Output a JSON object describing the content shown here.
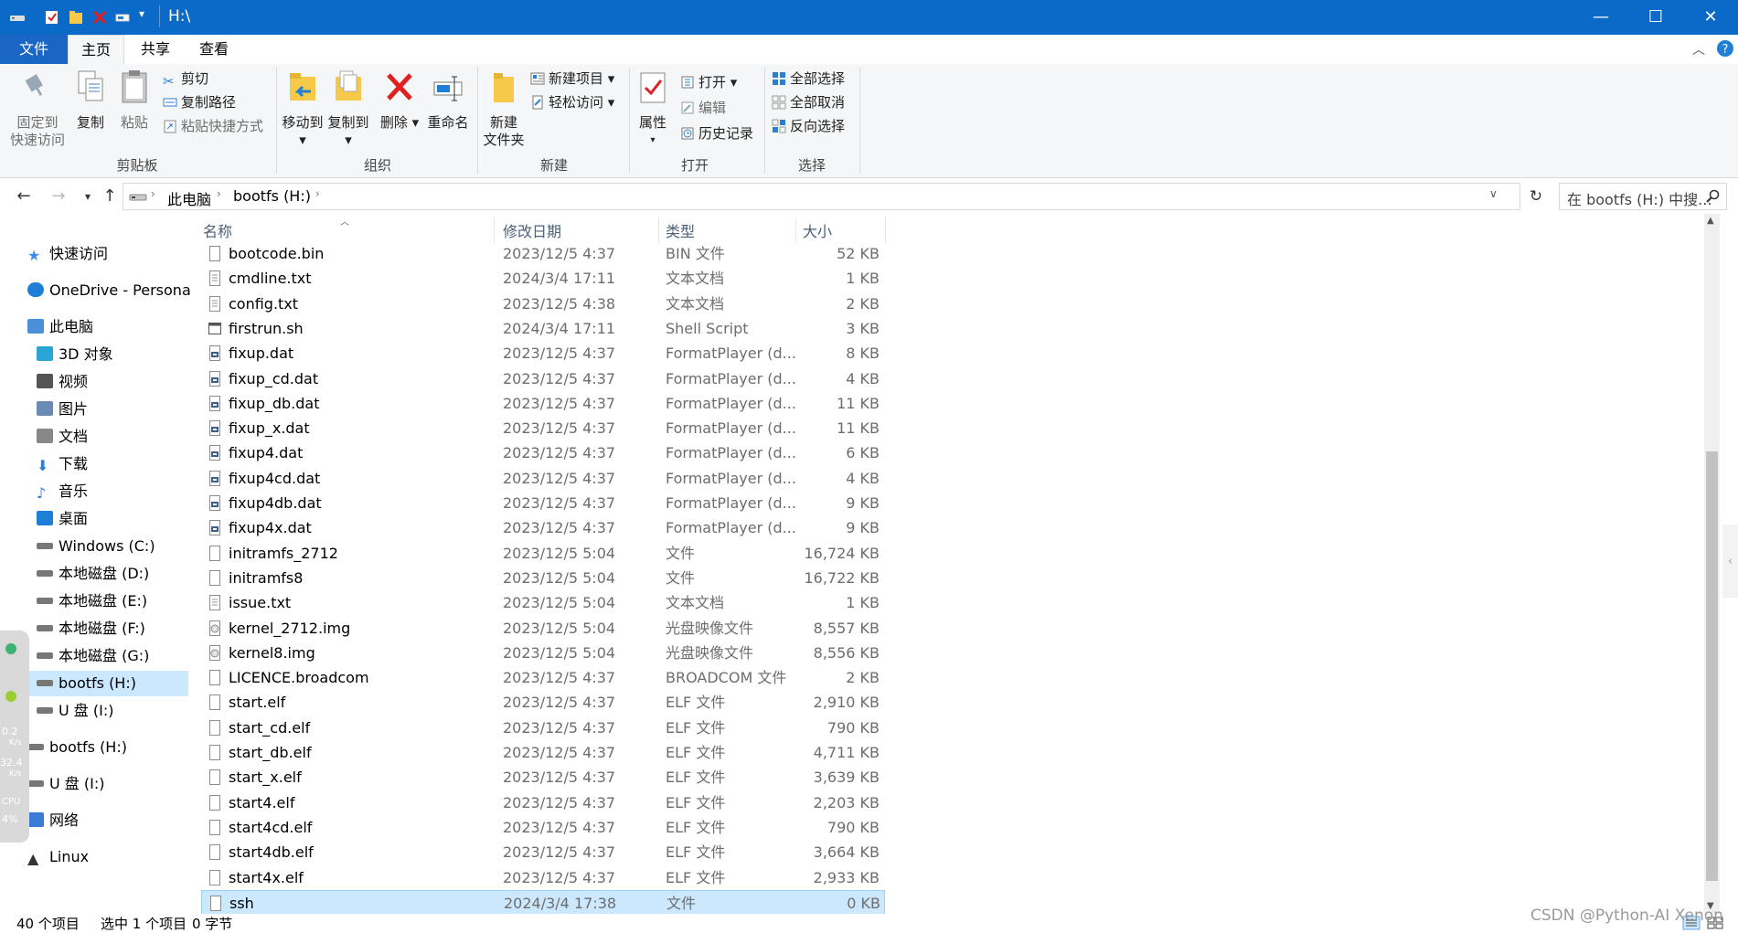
{
  "window": {
    "title": "H:\\",
    "controls": {
      "minimize": "—",
      "maximize": "☐",
      "close": "✕"
    }
  },
  "ribbon_tabs": [
    {
      "label": "文件"
    },
    {
      "label": "主页"
    },
    {
      "label": "共享"
    },
    {
      "label": "查看"
    }
  ],
  "ribbon": {
    "clipboard": {
      "label": "剪贴板",
      "pin_line1": "固定到",
      "pin_line2": "快速访问",
      "copy": "复制",
      "paste": "粘贴",
      "cut": "剪切",
      "copy_path": "复制路径",
      "paste_shortcut": "粘贴快捷方式"
    },
    "organize": {
      "label": "组织",
      "move_to": "移动到",
      "copy_to": "复制到",
      "delete": "删除",
      "rename": "重命名"
    },
    "new": {
      "label": "新建",
      "new_folder_line1": "新建",
      "new_folder_line2": "文件夹",
      "new_item": "新建项目",
      "easy_access": "轻松访问"
    },
    "open": {
      "label": "打开",
      "properties": "属性",
      "open": "打开",
      "edit": "编辑",
      "history": "历史记录"
    },
    "select": {
      "label": "选择",
      "select_all": "全部选择",
      "select_none": "全部取消",
      "invert": "反向选择"
    }
  },
  "address": {
    "crumbs": [
      "此电脑",
      "bootfs (H:)"
    ],
    "search_placeholder": "在 bootfs (H:) 中搜..."
  },
  "nav": [
    {
      "label": "快速访问",
      "icon": "star-icon",
      "indent": 0,
      "color": "#3a8ee6"
    },
    {
      "label": "OneDrive - Persona",
      "icon": "cloud-icon",
      "indent": 0,
      "color": "#1e7fd6"
    },
    {
      "label": "此电脑",
      "icon": "computer-icon",
      "indent": 0,
      "color": "#4a90d9"
    },
    {
      "label": "3D 对象",
      "icon": "cube-icon",
      "indent": 1,
      "color": "#2ba4d6"
    },
    {
      "label": "视频",
      "icon": "film-icon",
      "indent": 1,
      "color": "#555"
    },
    {
      "label": "图片",
      "icon": "picture-icon",
      "indent": 1,
      "color": "#6a8bb5"
    },
    {
      "label": "文档",
      "icon": "document-icon",
      "indent": 1,
      "color": "#888"
    },
    {
      "label": "下载",
      "icon": "download-icon",
      "indent": 1,
      "color": "#2a7fd4"
    },
    {
      "label": "音乐",
      "icon": "music-icon",
      "indent": 1,
      "color": "#2a7fd4"
    },
    {
      "label": "桌面",
      "icon": "desktop-icon",
      "indent": 1,
      "color": "#1e7fd6"
    },
    {
      "label": "Windows (C:)",
      "icon": "drive-windows-icon",
      "indent": 1,
      "color": "#777"
    },
    {
      "label": "本地磁盘 (D:)",
      "icon": "drive-icon",
      "indent": 1,
      "color": "#777"
    },
    {
      "label": "本地磁盘 (E:)",
      "icon": "drive-icon",
      "indent": 1,
      "color": "#777"
    },
    {
      "label": "本地磁盘 (F:)",
      "icon": "drive-icon",
      "indent": 1,
      "color": "#777"
    },
    {
      "label": "本地磁盘 (G:)",
      "icon": "drive-icon",
      "indent": 1,
      "color": "#777"
    },
    {
      "label": "bootfs (H:)",
      "icon": "drive-icon",
      "indent": 1,
      "color": "#777",
      "selected": true
    },
    {
      "label": "U 盘 (I:)",
      "icon": "usb-drive-icon",
      "indent": 1,
      "color": "#777"
    },
    {
      "label": "bootfs (H:)",
      "icon": "drive-icon",
      "indent": 0,
      "color": "#777"
    },
    {
      "label": "U 盘 (I:)",
      "icon": "usb-drive-icon",
      "indent": 0,
      "color": "#777"
    },
    {
      "label": "网络",
      "icon": "network-icon",
      "indent": 0,
      "color": "#3a7bd5"
    },
    {
      "label": "Linux",
      "icon": "linux-icon",
      "indent": 0,
      "color": "#333"
    }
  ],
  "columns": {
    "name": "名称",
    "date": "修改日期",
    "type": "类型",
    "size": "大小"
  },
  "files": [
    {
      "name": "bootcode.bin",
      "date": "2023/12/5 4:37",
      "type": "BIN 文件",
      "size": "52 KB",
      "icon": "file-icon"
    },
    {
      "name": "cmdline.txt",
      "date": "2024/3/4 17:11",
      "type": "文本文档",
      "size": "1 KB",
      "icon": "text-file-icon"
    },
    {
      "name": "config.txt",
      "date": "2023/12/5 4:38",
      "type": "文本文档",
      "size": "2 KB",
      "icon": "text-file-icon"
    },
    {
      "name": "firstrun.sh",
      "date": "2024/3/4 17:11",
      "type": "Shell Script",
      "size": "3 KB",
      "icon": "script-file-icon"
    },
    {
      "name": "fixup.dat",
      "date": "2023/12/5 4:37",
      "type": "FormatPlayer (d...",
      "size": "8 KB",
      "icon": "dat-file-icon"
    },
    {
      "name": "fixup_cd.dat",
      "date": "2023/12/5 4:37",
      "type": "FormatPlayer (d...",
      "size": "4 KB",
      "icon": "dat-file-icon"
    },
    {
      "name": "fixup_db.dat",
      "date": "2023/12/5 4:37",
      "type": "FormatPlayer (d...",
      "size": "11 KB",
      "icon": "dat-file-icon"
    },
    {
      "name": "fixup_x.dat",
      "date": "2023/12/5 4:37",
      "type": "FormatPlayer (d...",
      "size": "11 KB",
      "icon": "dat-file-icon"
    },
    {
      "name": "fixup4.dat",
      "date": "2023/12/5 4:37",
      "type": "FormatPlayer (d...",
      "size": "6 KB",
      "icon": "dat-file-icon"
    },
    {
      "name": "fixup4cd.dat",
      "date": "2023/12/5 4:37",
      "type": "FormatPlayer (d...",
      "size": "4 KB",
      "icon": "dat-file-icon"
    },
    {
      "name": "fixup4db.dat",
      "date": "2023/12/5 4:37",
      "type": "FormatPlayer (d...",
      "size": "9 KB",
      "icon": "dat-file-icon"
    },
    {
      "name": "fixup4x.dat",
      "date": "2023/12/5 4:37",
      "type": "FormatPlayer (d...",
      "size": "9 KB",
      "icon": "dat-file-icon"
    },
    {
      "name": "initramfs_2712",
      "date": "2023/12/5 5:04",
      "type": "文件",
      "size": "16,724 KB",
      "icon": "file-icon"
    },
    {
      "name": "initramfs8",
      "date": "2023/12/5 5:04",
      "type": "文件",
      "size": "16,722 KB",
      "icon": "file-icon"
    },
    {
      "name": "issue.txt",
      "date": "2023/12/5 5:04",
      "type": "文本文档",
      "size": "1 KB",
      "icon": "text-file-icon"
    },
    {
      "name": "kernel_2712.img",
      "date": "2023/12/5 5:04",
      "type": "光盘映像文件",
      "size": "8,557 KB",
      "icon": "disc-image-icon"
    },
    {
      "name": "kernel8.img",
      "date": "2023/12/5 5:04",
      "type": "光盘映像文件",
      "size": "8,556 KB",
      "icon": "disc-image-icon"
    },
    {
      "name": "LICENCE.broadcom",
      "date": "2023/12/5 4:37",
      "type": "BROADCOM 文件",
      "size": "2 KB",
      "icon": "file-icon"
    },
    {
      "name": "start.elf",
      "date": "2023/12/5 4:37",
      "type": "ELF 文件",
      "size": "2,910 KB",
      "icon": "file-icon"
    },
    {
      "name": "start_cd.elf",
      "date": "2023/12/5 4:37",
      "type": "ELF 文件",
      "size": "790 KB",
      "icon": "file-icon"
    },
    {
      "name": "start_db.elf",
      "date": "2023/12/5 4:37",
      "type": "ELF 文件",
      "size": "4,711 KB",
      "icon": "file-icon"
    },
    {
      "name": "start_x.elf",
      "date": "2023/12/5 4:37",
      "type": "ELF 文件",
      "size": "3,639 KB",
      "icon": "file-icon"
    },
    {
      "name": "start4.elf",
      "date": "2023/12/5 4:37",
      "type": "ELF 文件",
      "size": "2,203 KB",
      "icon": "file-icon"
    },
    {
      "name": "start4cd.elf",
      "date": "2023/12/5 4:37",
      "type": "ELF 文件",
      "size": "790 KB",
      "icon": "file-icon"
    },
    {
      "name": "start4db.elf",
      "date": "2023/12/5 4:37",
      "type": "ELF 文件",
      "size": "3,664 KB",
      "icon": "file-icon"
    },
    {
      "name": "start4x.elf",
      "date": "2023/12/5 4:37",
      "type": "ELF 文件",
      "size": "2,933 KB",
      "icon": "file-icon"
    },
    {
      "name": "ssh",
      "date": "2024/3/4 17:38",
      "type": "文件",
      "size": "0 KB",
      "icon": "file-icon",
      "selected": true
    }
  ],
  "status": {
    "item_count": "40 个项目",
    "selection": "选中 1 个项目",
    "selection_size": "0 字节"
  },
  "side_widget": {
    "up_speed": "0.2",
    "up_unit": "K/s",
    "down_speed": "32.4",
    "down_unit": "K/s",
    "cpu_label": "CPU",
    "cpu_value": "4%"
  },
  "watermark": "CSDN @Python-AI Xenon",
  "colors": {
    "accent": "#0b69c7",
    "selection": "#cce8ff",
    "selection_border": "#99d1ff"
  }
}
